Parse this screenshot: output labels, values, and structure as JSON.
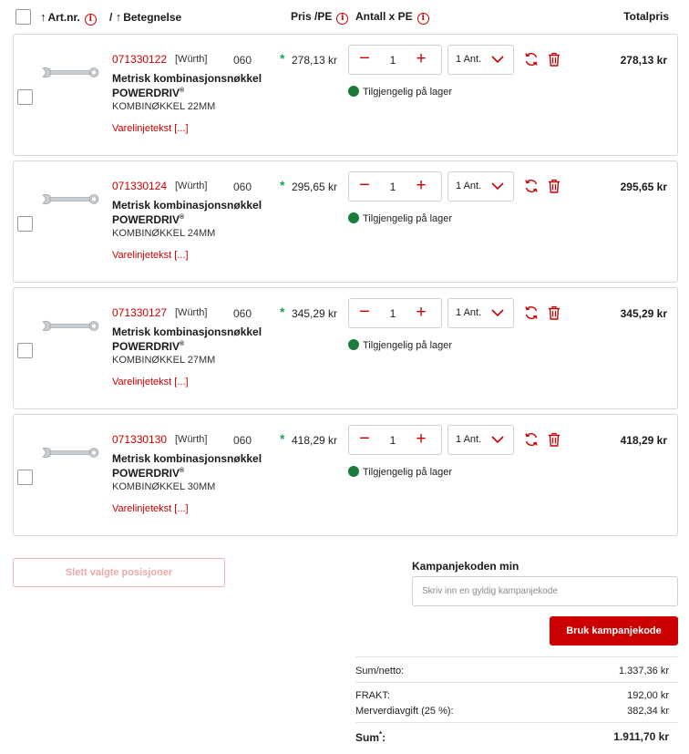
{
  "header": {
    "col_artnr": "Art.nr.",
    "col_sep": "/",
    "col_betegnelse": "Betegnelse",
    "col_pris": "Pris /PE",
    "col_antall": "Antall x PE",
    "col_totalpris": "Totalpris",
    "info_icon": "i"
  },
  "items": [
    {
      "artnr": "071330122",
      "brand": "[Würth]",
      "pe": "060",
      "name": "Metrisk kombinasjonsnøkkel POWERDRIV",
      "reg": "®",
      "sub": "KOMBINØKKEL 22MM",
      "varelinjetekst": "Varelinjetekst [...]",
      "price": "278,13 kr",
      "qty": "1",
      "unit": "1 Ant.",
      "stock": "Tilgjengelig på lager",
      "total": "278,13 kr"
    },
    {
      "artnr": "071330124",
      "brand": "[Würth]",
      "pe": "060",
      "name": "Metrisk kombinasjonsnøkkel POWERDRIV",
      "reg": "®",
      "sub": "KOMBINØKKEL 24MM",
      "varelinjetekst": "Varelinjetekst [...]",
      "price": "295,65 kr",
      "qty": "1",
      "unit": "1 Ant.",
      "stock": "Tilgjengelig på lager",
      "total": "295,65 kr"
    },
    {
      "artnr": "071330127",
      "brand": "[Würth]",
      "pe": "060",
      "name": "Metrisk kombinasjonsnøkkel POWERDRIV",
      "reg": "®",
      "sub": "KOMBINØKKEL 27MM",
      "varelinjetekst": "Varelinjetekst [...]",
      "price": "345,29 kr",
      "qty": "1",
      "unit": "1 Ant.",
      "stock": "Tilgjengelig på lager",
      "total": "345,29 kr"
    },
    {
      "artnr": "071330130",
      "brand": "[Würth]",
      "pe": "060",
      "name": "Metrisk kombinasjonsnøkkel POWERDRIV",
      "reg": "®",
      "sub": "KOMBINØKKEL 30MM",
      "varelinjetekst": "Varelinjetekst [...]",
      "price": "418,29 kr",
      "qty": "1",
      "unit": "1 Ant.",
      "stock": "Tilgjengelig på lager",
      "total": "418,29 kr"
    }
  ],
  "actions": {
    "delete_selected": "Slett valgte posisjoner"
  },
  "campaign": {
    "title": "Kampanjekoden min",
    "placeholder": "Skriv inn en gyldig kampanjekode",
    "button": "Bruk kampanjekode"
  },
  "summary": {
    "sum_netto_label": "Sum/netto:",
    "sum_netto_value": "1.337,36 kr",
    "frakt_label": "FRAKT:",
    "frakt_value": "192,00 kr",
    "mva_label": "Merverdiavgift (25 %):",
    "mva_value": "382,34 kr",
    "sum_label": "Sum",
    "sum_mark": "*",
    "sum_colon": ":",
    "sum_value": "1.911,70 kr"
  },
  "colors": {
    "accent": "#cc0000",
    "stock_green": "#1a7c3a",
    "star_green": "#1ea454"
  },
  "icons": {
    "sort": "up-arrow-icon",
    "info": "info-circle-icon",
    "refresh": "refresh-icon",
    "delete": "trash-icon",
    "chevron": "chevron-down-icon",
    "star": "star-icon",
    "stock": "status-dot-icon"
  }
}
